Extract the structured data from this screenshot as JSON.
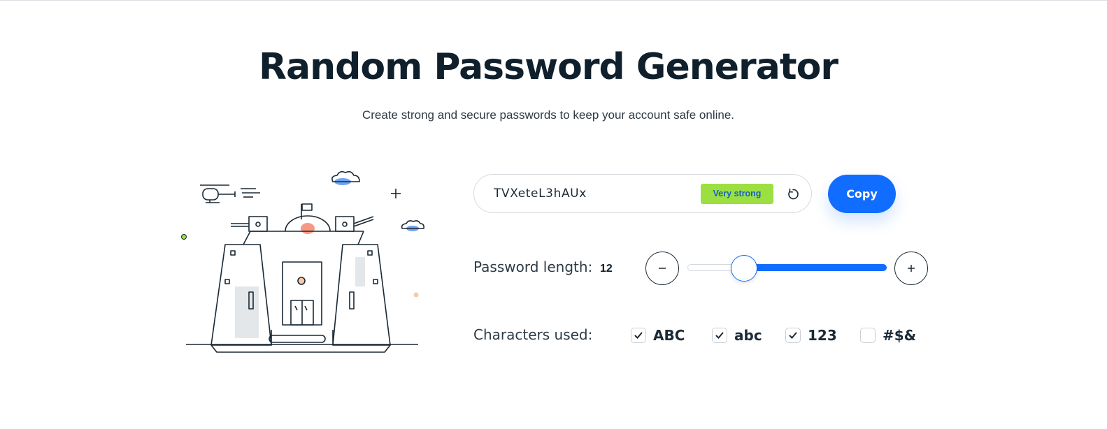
{
  "header": {
    "title": "Random Password Generator",
    "subtitle": "Create strong and secure passwords to keep your account safe online."
  },
  "password": {
    "value": "TVXeteL3hAUx",
    "strength": "Very strong",
    "copy_label": "Copy"
  },
  "length": {
    "label": "Password length:",
    "value": "12",
    "slider_fraction": 0.25
  },
  "characters": {
    "label": "Characters used:",
    "options": [
      {
        "label": "ABC",
        "checked": true
      },
      {
        "label": "abc",
        "checked": true
      },
      {
        "label": "123",
        "checked": true
      },
      {
        "label": "#$&",
        "checked": false
      }
    ]
  },
  "colors": {
    "accent": "#116dff",
    "strength_bg": "#9be040",
    "illustration_orange": "#f6866d",
    "illustration_blue": "#5f98f2"
  },
  "icons": {
    "refresh": "refresh-icon",
    "minus": "minus-icon",
    "plus": "plus-icon",
    "check": "check-icon"
  }
}
